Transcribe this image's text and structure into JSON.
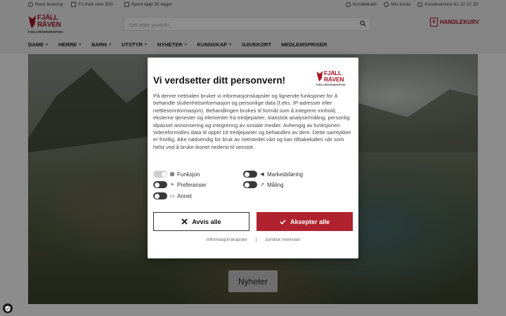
{
  "topbar": {
    "left": [
      "Rask levering",
      "Fri frakt over 500,-",
      "Åpent kjøp 30 dager"
    ],
    "right": [
      "Kundeklubb",
      "Min konto",
      "Kundeservice 61 22 22 25"
    ]
  },
  "logo": {
    "line1": "FJÄLL",
    "line2": "RÄVEN",
    "domain": "FJELLREVENSHOP.NO"
  },
  "search": {
    "placeholder": "Søk etter produkt"
  },
  "cart": {
    "count": "0",
    "label": "HANDLEKURV"
  },
  "nav": [
    {
      "label": "DAME",
      "dropdown": true
    },
    {
      "label": "HERRE",
      "dropdown": true
    },
    {
      "label": "BARN",
      "dropdown": true
    },
    {
      "label": "UTSTYR",
      "dropdown": true
    },
    {
      "label": "NYHETER",
      "dropdown": true
    },
    {
      "label": "KUNNSKAP",
      "dropdown": true
    },
    {
      "label": "GAVEKORT",
      "dropdown": false
    },
    {
      "label": "MEDLEMSPRISER",
      "dropdown": false
    }
  ],
  "hero": {
    "button": "Nyheter"
  },
  "consent": {
    "title": "Vi verdsetter ditt personvern!",
    "body": "På denne nettsiden bruker vi informasjonskapsler og lignende funksjoner for å behandle sluttenhetsinformasjon og personlige data (f.eks. IP-adresser eller nettleserinformasjon). Behandlingen brukes til formål som å integrere innhold, eksterne tjenester og elementer fra tredjeparter, statistisk analyse/måling, personlig tilpasset annonsering og integrering av sosiale medier. Avhengig av funksjonen videreformidles data til opptil 16 tredjeparter og behandles av dem. Dette samtykket er frivillig, ikke nødvendig for bruk av nettstedet vårt og kan tilbakekalles når som helst ved å bruke ikonet nederst til venstre.",
    "toggles": [
      {
        "label": "Funksjon",
        "on": true,
        "icon": "grid-icon"
      },
      {
        "label": "Markedsføring",
        "on": false,
        "icon": "megaphone-icon"
      },
      {
        "label": "Preferanser",
        "on": false,
        "icon": "sliders-icon"
      },
      {
        "label": "Måling",
        "on": false,
        "icon": "chart-icon"
      },
      {
        "label": "Annet",
        "on": false,
        "icon": "chat-icon"
      }
    ],
    "reject_label": "Avvis alle",
    "accept_label": "Aksepter alle",
    "link_cookies": "Informasjonskapsler",
    "link_separator": "|",
    "link_legal": "Juridisk merknad"
  },
  "colors": {
    "brand": "#a8142a",
    "accept": "#b0232e"
  }
}
